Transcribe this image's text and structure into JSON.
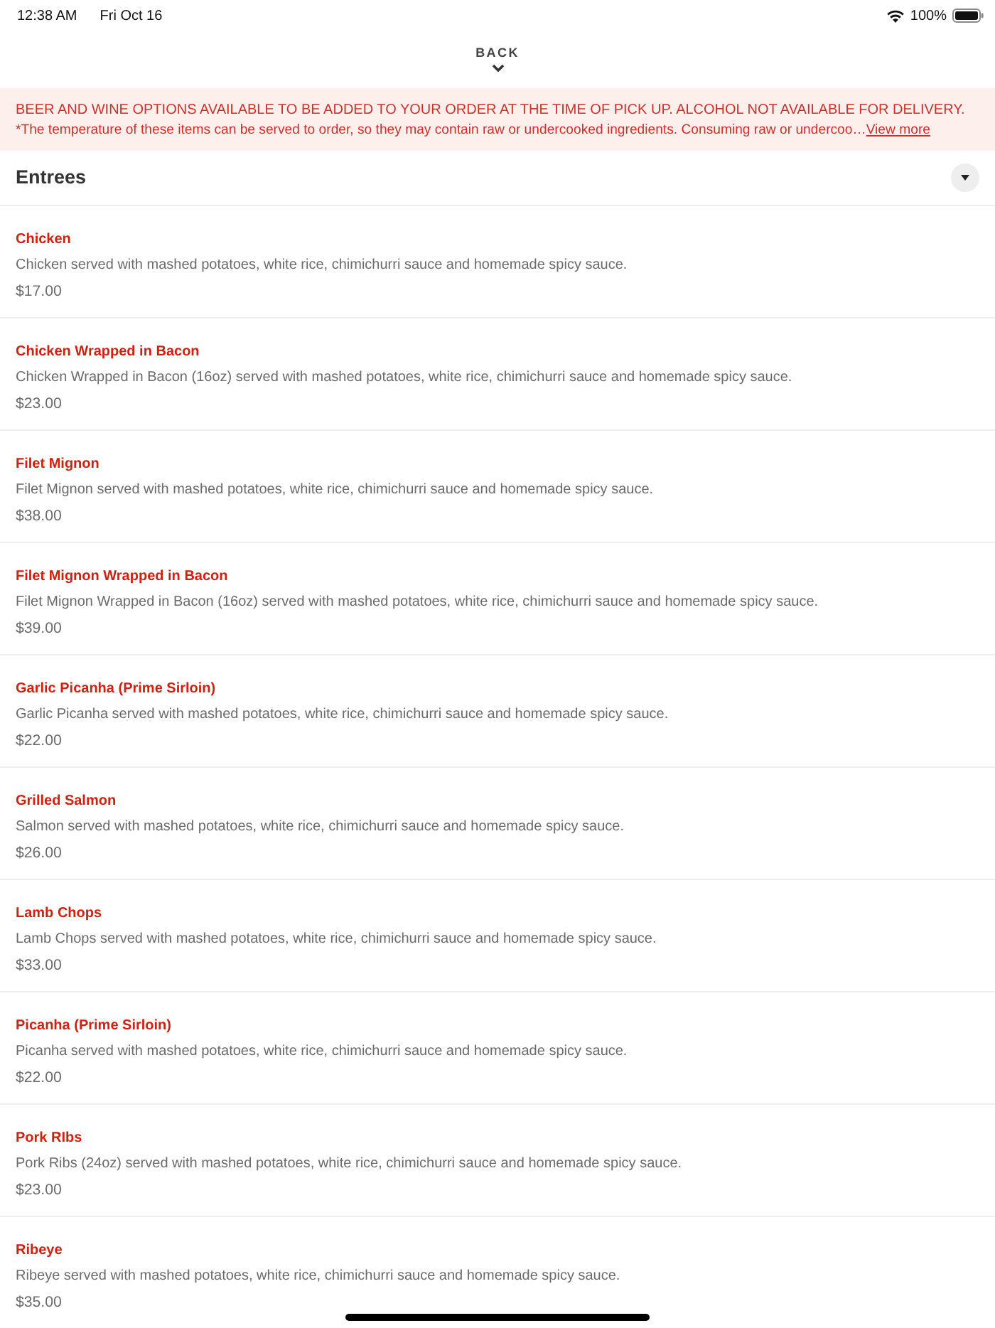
{
  "status_bar": {
    "time": "12:38 AM",
    "date": "Fri Oct 16",
    "battery": "100%"
  },
  "back_button": {
    "label": "BACK"
  },
  "notice": {
    "headline": "BEER AND WINE OPTIONS AVAILABLE TO BE ADDED TO YOUR ORDER AT THE TIME OF PICK UP. ALCOHOL NOT AVAILABLE FOR DELIVERY.",
    "detail": "*The temperature of these items can be served to order, so they may contain raw or undercooked ingredients. Consuming raw or undercoo…",
    "link": "View more"
  },
  "category": {
    "title": "Entrees"
  },
  "items": [
    {
      "name": "Chicken",
      "description": "Chicken served with mashed potatoes, white rice, chimichurri sauce and homemade spicy sauce.",
      "price": "$17.00"
    },
    {
      "name": "Chicken Wrapped in Bacon",
      "description": "Chicken Wrapped in Bacon (16oz) served with mashed potatoes, white rice, chimichurri sauce and homemade spicy sauce.",
      "price": "$23.00"
    },
    {
      "name": "Filet Mignon",
      "description": "Filet Mignon served with mashed potatoes, white rice, chimichurri sauce and homemade spicy sauce.",
      "price": "$38.00"
    },
    {
      "name": "Filet Mignon Wrapped in Bacon",
      "description": "Filet Mignon Wrapped in Bacon (16oz) served with mashed potatoes, white rice, chimichurri sauce and homemade spicy sauce.",
      "price": "$39.00"
    },
    {
      "name": "Garlic Picanha (Prime Sirloin)",
      "description": "Garlic Picanha served with mashed potatoes, white rice, chimichurri sauce and homemade spicy sauce.",
      "price": "$22.00"
    },
    {
      "name": "Grilled Salmon",
      "description": "Salmon served with mashed potatoes, white rice, chimichurri sauce and homemade spicy sauce.",
      "price": "$26.00"
    },
    {
      "name": "Lamb Chops",
      "description": "Lamb Chops served with mashed potatoes, white rice, chimichurri sauce and homemade spicy sauce.",
      "price": "$33.00"
    },
    {
      "name": "Picanha (Prime Sirloin)",
      "description": "Picanha served with mashed potatoes, white rice, chimichurri sauce and homemade spicy sauce.",
      "price": "$22.00"
    },
    {
      "name": "Pork RIbs",
      "description": "Pork Ribs (24oz) served with mashed potatoes, white rice, chimichurri sauce and homemade spicy sauce.",
      "price": "$23.00"
    },
    {
      "name": "Ribeye",
      "description": "Ribeye served with mashed potatoes, white rice, chimichurri sauce and homemade spicy sauce.",
      "price": "$35.00"
    }
  ]
}
